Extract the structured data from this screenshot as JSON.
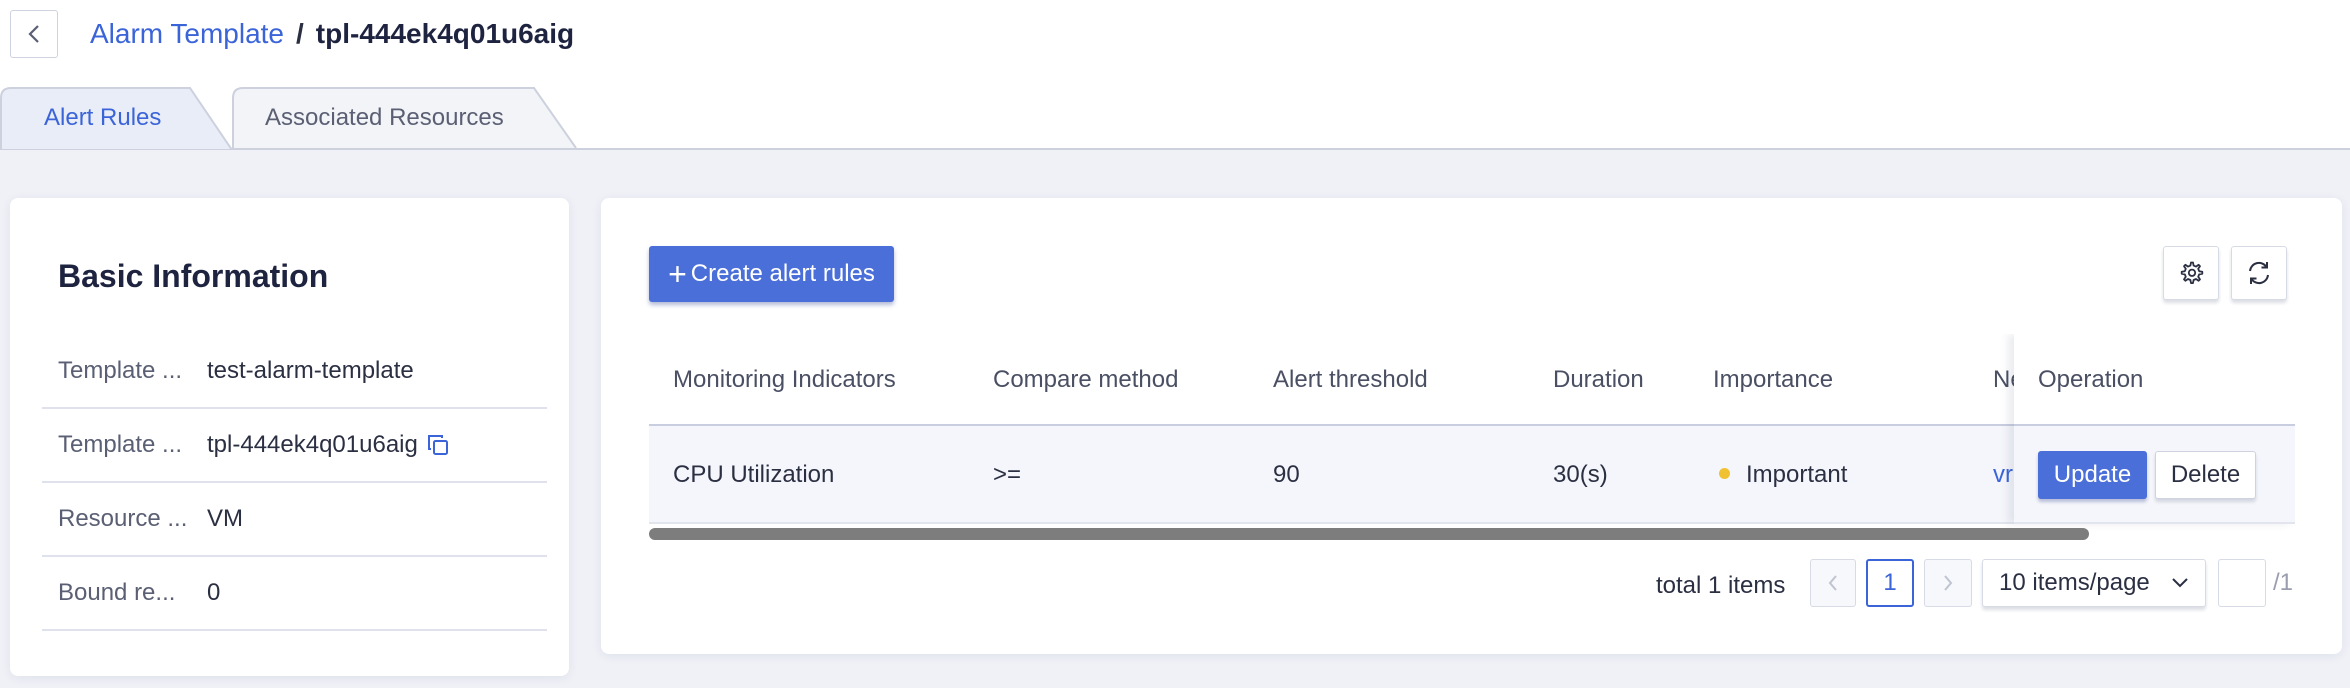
{
  "breadcrumb": {
    "parent": "Alarm Template",
    "separator": "/",
    "current": "tpl-444ek4q01u6aig"
  },
  "tabs": [
    {
      "label": "Alert Rules",
      "active": true
    },
    {
      "label": "Associated Resources",
      "active": false
    }
  ],
  "basic_info": {
    "title": "Basic Information",
    "rows": [
      {
        "label": "Template ...",
        "value": "test-alarm-template"
      },
      {
        "label": "Template ...",
        "value": "tpl-444ek4q01u6aig"
      },
      {
        "label": "Resource ...",
        "value": "VM"
      },
      {
        "label": "Bound re...",
        "value": "0"
      }
    ]
  },
  "toolbar": {
    "create_label": "Create alert rules",
    "settings_icon": "gear-icon",
    "refresh_icon": "refresh-icon"
  },
  "table": {
    "columns": [
      "Monitoring Indicators",
      "Compare method",
      "Alert threshold",
      "Duration",
      "Importance",
      "Ne",
      "Operation"
    ],
    "rows": [
      {
        "indicator": "CPU Utilization",
        "compare": ">=",
        "threshold": "90",
        "duration": "30(s)",
        "importance": "Important",
        "importance_color": "#f0c232",
        "notify": "vr",
        "update_label": "Update",
        "delete_label": "Delete"
      }
    ]
  },
  "pagination": {
    "total_text": "total 1 items",
    "current_page": "1",
    "page_size": "10 items/page",
    "jump_value": "",
    "total_pages": "/1"
  },
  "colors": {
    "accent": "#3a64d8",
    "primary_button": "#4b6fd9",
    "background": "#f0f1f7"
  }
}
